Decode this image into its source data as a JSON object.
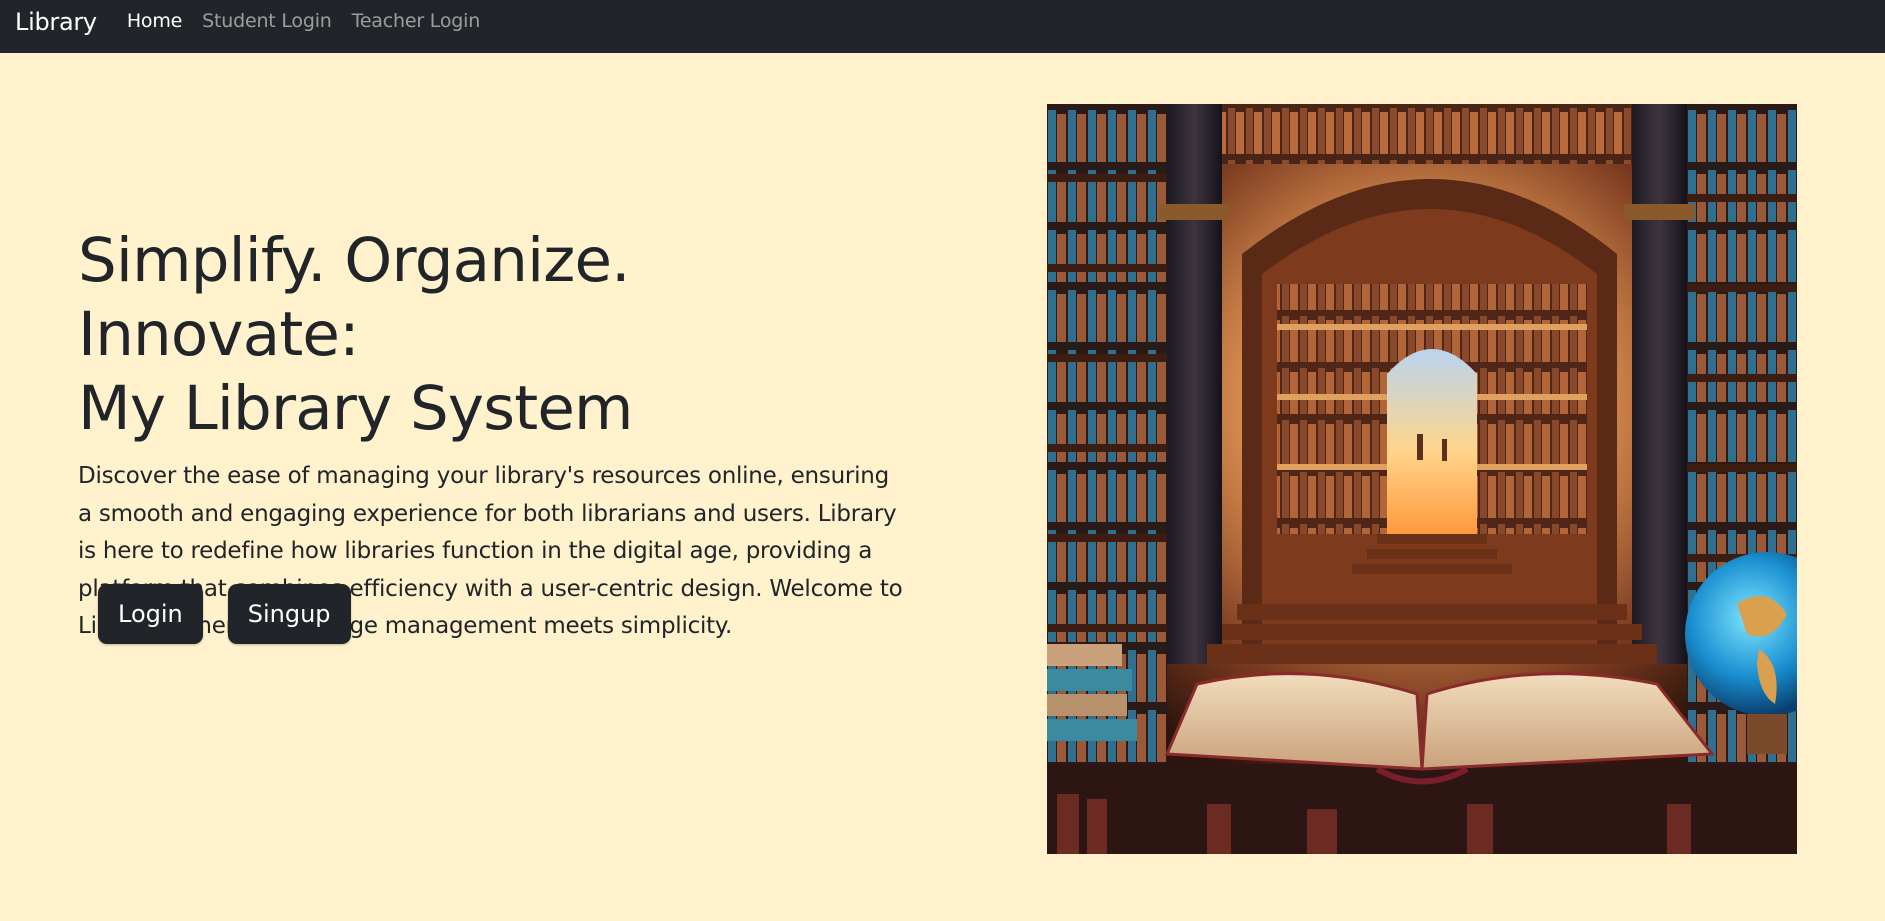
{
  "navbar": {
    "brand": "Library",
    "links": [
      {
        "label": "Home",
        "active": true
      },
      {
        "label": "Student Login",
        "active": false
      },
      {
        "label": "Teacher Login",
        "active": false
      }
    ]
  },
  "hero": {
    "headline_line1": "Simplify. Organize. Innovate:",
    "headline_line2": "My Library System",
    "description": "Discover the ease of managing your library's resources online, ensuring a smooth and engaging experience for both librarians and users. Library is here to redefine how libraries function in the digital age, providing a platform that combines efficiency with a user-centric design. Welcome to Library - where knowledge management meets simplicity.",
    "buttons": {
      "login_label": "Login",
      "signup_label": "Singup"
    }
  },
  "colors": {
    "page_background": "#fff2cc",
    "navbar_background": "#212529",
    "button_background": "#212529"
  },
  "image": {
    "alt": "library-illustration"
  }
}
